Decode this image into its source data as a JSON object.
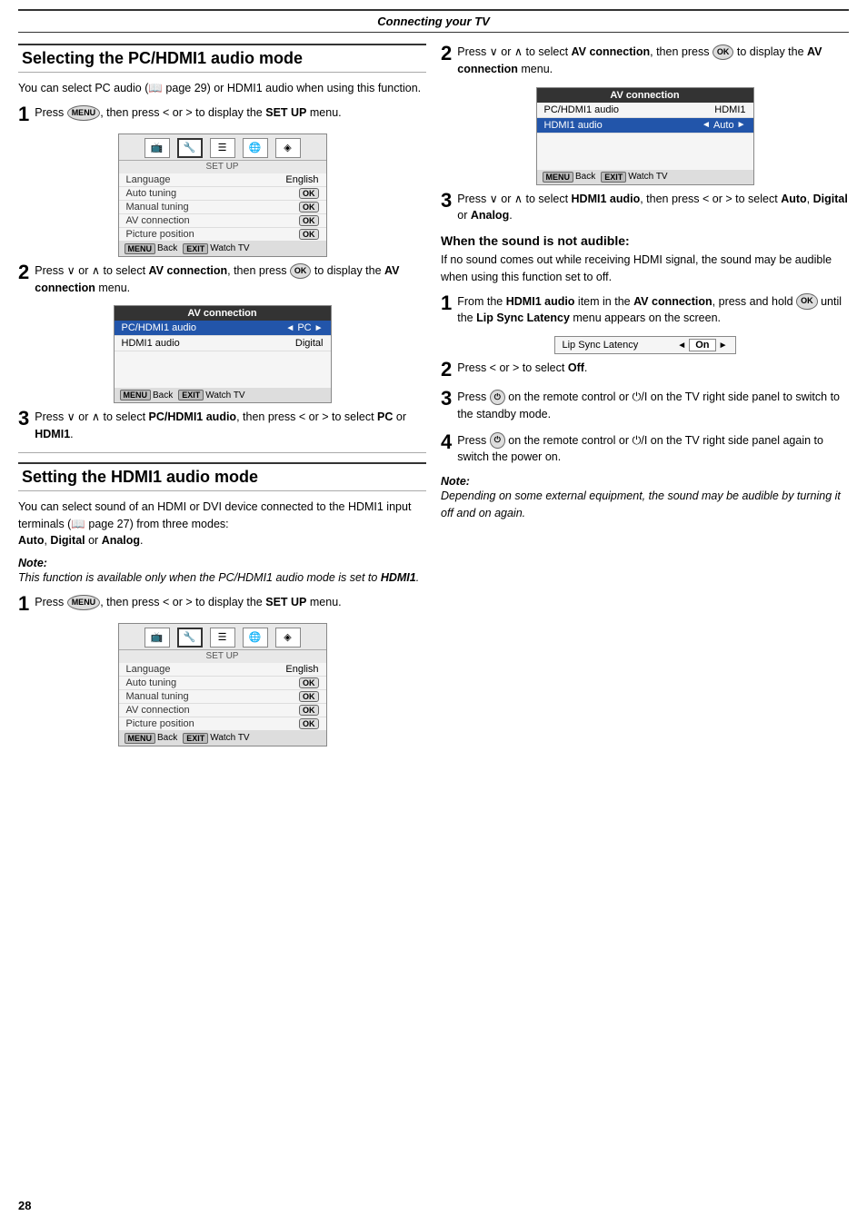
{
  "header": {
    "title": "Connecting your TV"
  },
  "page_number": "28",
  "left_col": {
    "section1": {
      "title": "Selecting the PC/HDMI1 audio mode",
      "description": "You can select PC audio (☞ page 29) or HDMI1 audio when using this function.",
      "steps": [
        {
          "num": "1",
          "text": "Press , then press < or > to display the SET UP menu.",
          "has_menu": true,
          "menu": {
            "title": "SET UP",
            "icons": [
              "📺",
              "🔧",
              "📋",
              "🌐",
              "🎛"
            ],
            "rows": [
              {
                "label": "Language",
                "value": "English",
                "type": "text"
              },
              {
                "label": "Auto tuning",
                "value": "OK",
                "type": "ok"
              },
              {
                "label": "Manual tuning",
                "value": "OK",
                "type": "ok"
              },
              {
                "label": "AV connection",
                "value": "OK",
                "type": "ok"
              },
              {
                "label": "Picture position",
                "value": "OK",
                "type": "ok"
              }
            ],
            "nav": [
              {
                "btn": "MENU",
                "label": "Back"
              },
              {
                "btn": "EXIT",
                "label": "Watch TV"
              }
            ]
          }
        },
        {
          "num": "2",
          "text": "Press ∨ or ∧ to select AV connection, then press OK to display the AV connection menu.",
          "has_menu": true,
          "menu": {
            "title": "AV connection",
            "rows": [
              {
                "label": "PC/HDMI1 audio",
                "value": "PC",
                "highlighted": true
              },
              {
                "label": "HDMI1 audio",
                "value": "Digital",
                "highlighted": false
              }
            ],
            "nav": [
              {
                "btn": "MENU",
                "label": "Back"
              },
              {
                "btn": "EXIT",
                "label": "Watch TV"
              }
            ]
          }
        },
        {
          "num": "3",
          "text": "Press ∨ or ∧ to select PC/HDMI1 audio, then press < or > to select PC or HDMI1."
        }
      ]
    },
    "section2": {
      "title": "Setting the HDMI1 audio mode",
      "description": "You can select sound of an HDMI or DVI device connected to the HDMI1 input terminals (☞ page 27) from three modes:\nAuto, Digital or Analog.",
      "note": {
        "title": "Note:",
        "text": "This function is available only when the PC/HDMI1 audio mode is set to HDMI1."
      },
      "steps": [
        {
          "num": "1",
          "text": "Press , then press < or > to display the SET UP menu.",
          "has_menu": true,
          "menu": {
            "title": "SET UP",
            "rows": [
              {
                "label": "Language",
                "value": "English",
                "type": "text"
              },
              {
                "label": "Auto tuning",
                "value": "OK",
                "type": "ok"
              },
              {
                "label": "Manual tuning",
                "value": "OK",
                "type": "ok"
              },
              {
                "label": "AV connection",
                "value": "OK",
                "type": "ok"
              },
              {
                "label": "Picture position",
                "value": "OK",
                "type": "ok"
              }
            ],
            "nav": [
              {
                "btn": "MENU",
                "label": "Back"
              },
              {
                "btn": "EXIT",
                "label": "Watch TV"
              }
            ]
          }
        }
      ]
    }
  },
  "right_col": {
    "step2": {
      "num": "2",
      "text": "Press ∨ or ∧ to select AV connection, then press OK to display the AV connection menu.",
      "menu": {
        "title": "AV connection",
        "rows": [
          {
            "label": "PC/HDMI1 audio",
            "value": "HDMI1",
            "highlighted": false
          },
          {
            "label": "HDMI1 audio",
            "value": "Auto",
            "highlighted": true,
            "has_arrows": true
          }
        ],
        "nav": [
          {
            "btn": "MENU",
            "label": "Back"
          },
          {
            "btn": "EXIT",
            "label": "Watch TV"
          }
        ]
      }
    },
    "step3": {
      "num": "3",
      "text": "Press ∨ or ∧ to select HDMI1 audio, then press < or > to select Auto, Digital or Analog."
    },
    "when_not_audible": {
      "title": "When the sound is not audible:",
      "description": "If no sound comes out while receiving HDMI signal, the sound may be audible when using this function set to off.",
      "steps": [
        {
          "num": "1",
          "text": "From the HDMI1 audio item in the AV connection, press and hold OK until the Lip Sync Latency menu appears on the screen.",
          "lip_sync": {
            "label": "Lip Sync Latency",
            "value": "On"
          }
        },
        {
          "num": "2",
          "text": "Press < or > to select Off."
        },
        {
          "num": "3",
          "text": "Press ⏻ on the remote control or ⏻/I on the TV right side panel to switch to the standby mode."
        },
        {
          "num": "4",
          "text": "Press ⏻ on the remote control or ⏻/I on the TV right side panel again to switch the power on."
        }
      ],
      "note": {
        "title": "Note:",
        "text": "Depending on some external equipment, the sound may be audible by turning it off and on again."
      }
    }
  }
}
